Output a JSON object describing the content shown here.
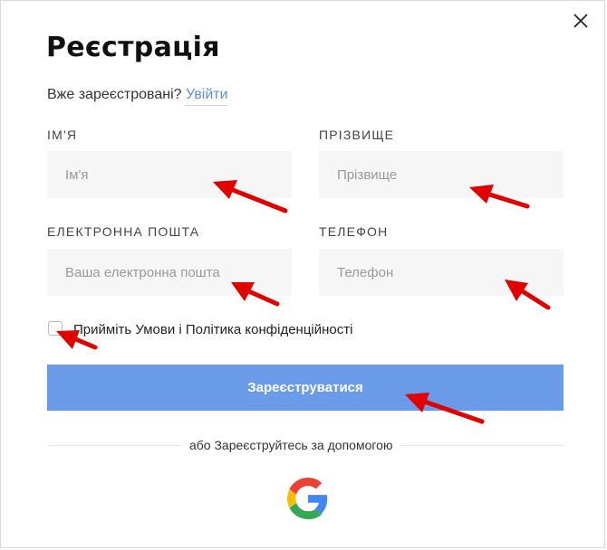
{
  "modal": {
    "title": "Реєстрація",
    "login_prompt": "Вже зареєстровані?",
    "login_link": "Увійти",
    "close_icon": "close-icon"
  },
  "form": {
    "first_name": {
      "label": "ІМ'Я",
      "placeholder": "Ім'я",
      "value": ""
    },
    "last_name": {
      "label": "ПРІЗВИЩЕ",
      "placeholder": "Прізвище",
      "value": ""
    },
    "email": {
      "label": "ЕЛЕКТРОННА ПОШТА",
      "placeholder": "Ваша електронна пошта",
      "value": ""
    },
    "phone": {
      "label": "ТЕЛЕФОН",
      "placeholder": "Телефон",
      "value": ""
    },
    "terms": {
      "text": "Прийміть Умови і Політика конфіденційності",
      "checked": false
    },
    "submit_label": "Зареєструватися"
  },
  "social": {
    "divider_text": "або Зареєструйтесь за допомогою",
    "google_icon": "google-logo-icon"
  },
  "colors": {
    "accent": "#6a9be9",
    "link": "#5d8ee0",
    "input_bg": "#f6f6f6",
    "annotation_arrow": "#e00000"
  }
}
